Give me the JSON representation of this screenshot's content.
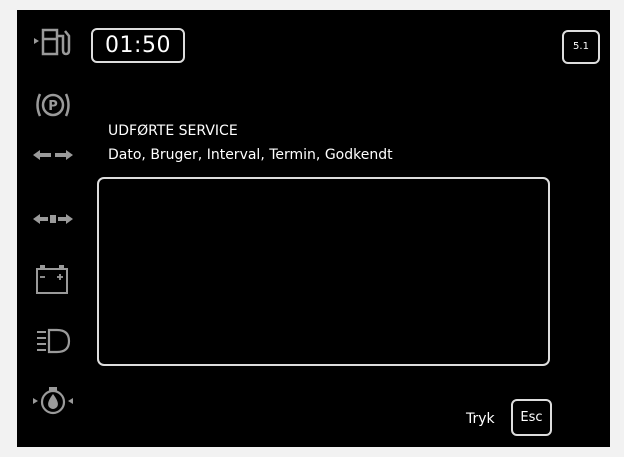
{
  "header": {
    "time": "01:50",
    "page_number": "5.1"
  },
  "main": {
    "title": "UDFØRTE SERVICE",
    "subtitle": "Dato, Bruger, Interval, Termin, Godkendt",
    "list_rows": []
  },
  "footer": {
    "prompt_label": "Tryk",
    "esc_label": "Esc"
  },
  "sidebar": {
    "icons": [
      "fuel-pump-icon",
      "parking-brake-icon",
      "turn-signal-left-right-icon",
      "turn-signal-trailer-icon",
      "battery-icon",
      "headlight-icon",
      "oil-pressure-icon"
    ]
  },
  "colors": {
    "background": "#000000",
    "foreground": "#ffffff",
    "icon": "#9a9a9a",
    "frame": "#dddddd"
  }
}
